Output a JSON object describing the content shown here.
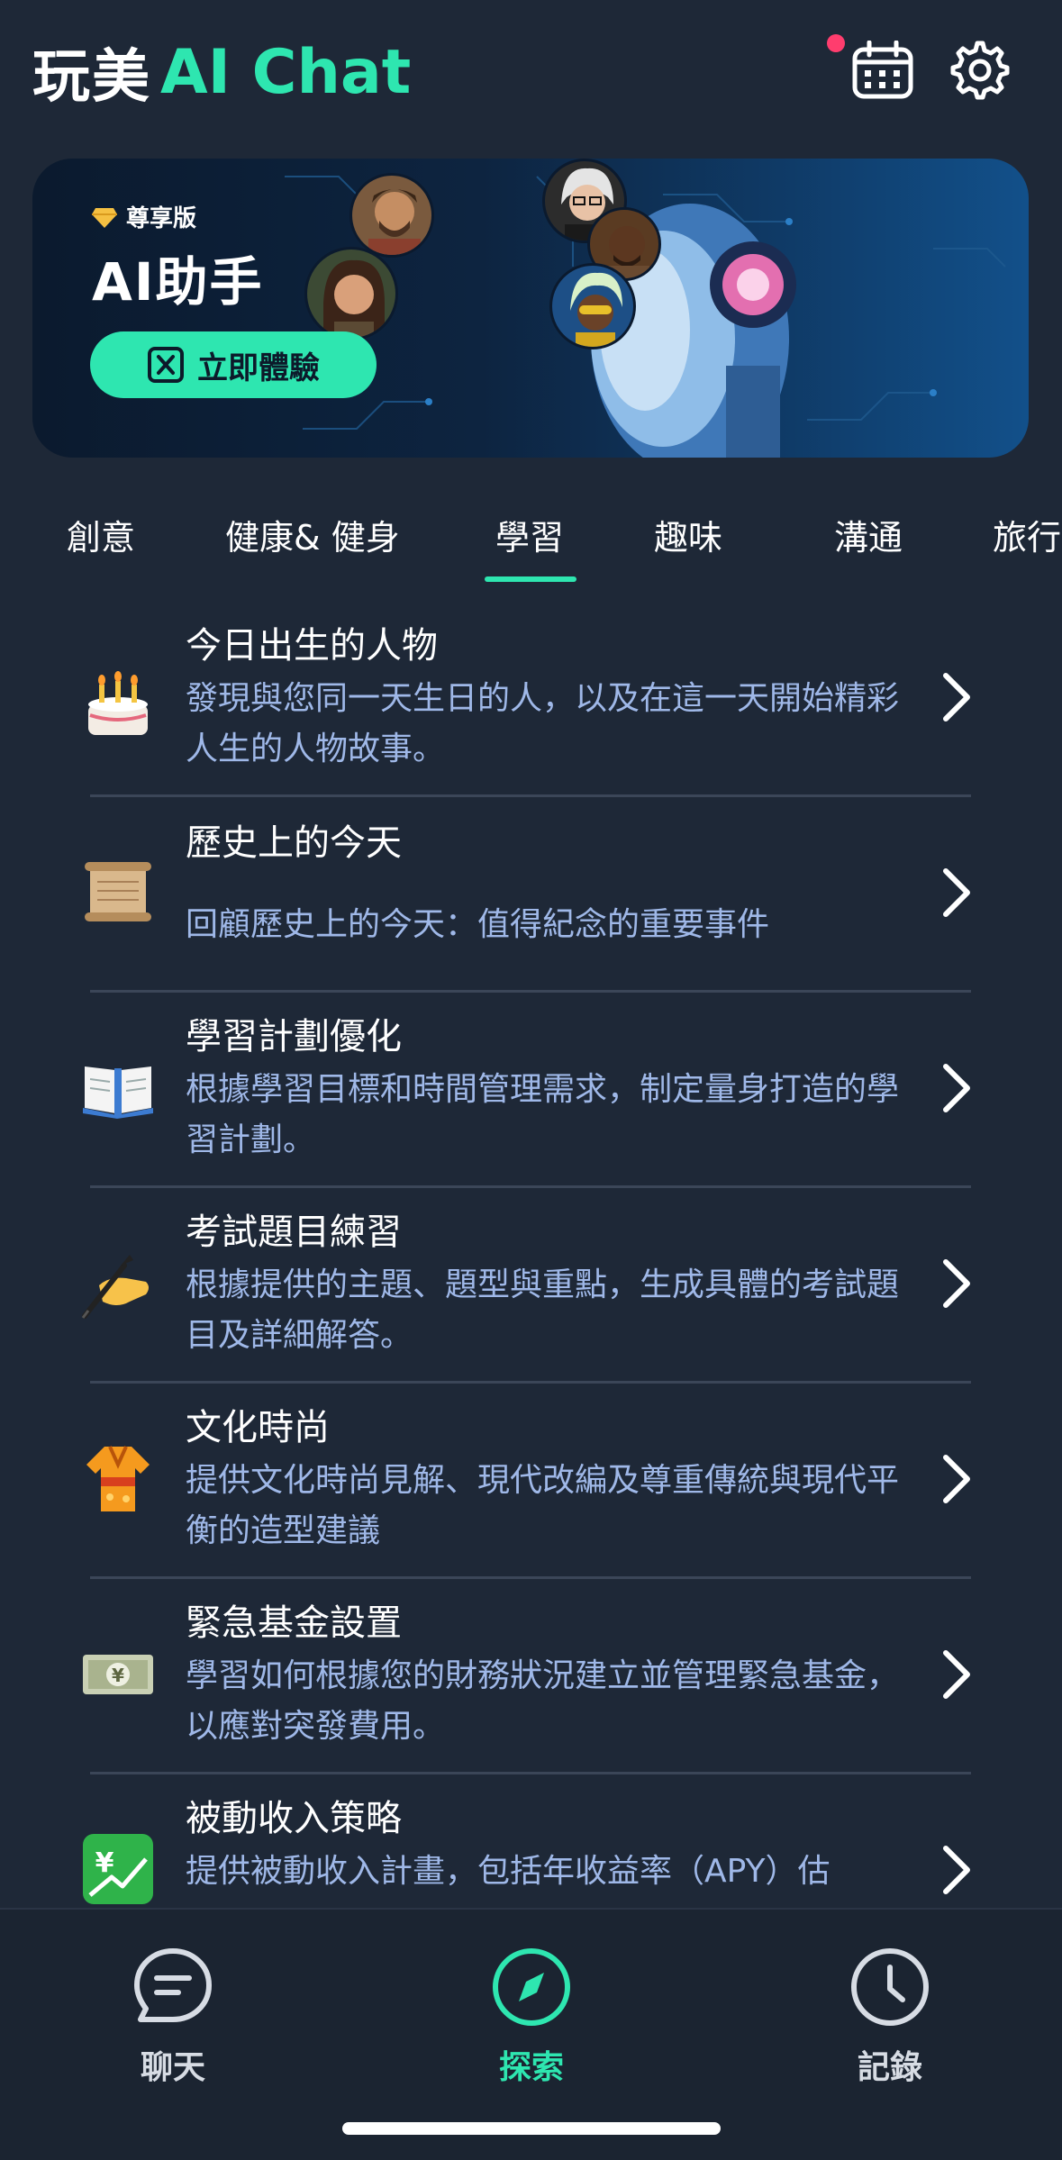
{
  "header": {
    "logo_cn": "玩美",
    "logo_ai": "AI Chat",
    "calendar_icon": "calendar-icon",
    "settings_icon": "gear-icon",
    "notification_color": "#ff3d6e"
  },
  "banner": {
    "premium_label": "尊享版",
    "title": "AI助手",
    "cta_label": "立即體驗",
    "accent": "#2ee6b0"
  },
  "tabs": [
    {
      "label": "創意",
      "active": false
    },
    {
      "label": "健康& 健身",
      "active": false
    },
    {
      "label": "學習",
      "active": true
    },
    {
      "label": "趣味",
      "active": false
    },
    {
      "label": "溝通",
      "active": false
    },
    {
      "label": "旅行",
      "active": false
    }
  ],
  "items": [
    {
      "icon": "birthday-cake-icon",
      "title": "今日出生的人物",
      "desc": "發現與您同一天生日的人，以及在這一天開始精彩人生的人物故事。"
    },
    {
      "icon": "scroll-icon",
      "title": "歷史上的今天",
      "desc": "回顧歷史上的今天：值得紀念的重要事件"
    },
    {
      "icon": "open-book-icon",
      "title": "學習計劃優化",
      "desc": "根據學習目標和時間管理需求，制定量身打造的學習計劃。"
    },
    {
      "icon": "writing-hand-icon",
      "title": "考試題目練習",
      "desc": "根據提供的主題、題型與重點，生成具體的考試題目及詳細解答。"
    },
    {
      "icon": "kimono-icon",
      "title": "文化時尚",
      "desc": "提供文化時尚見解、現代改編及尊重傳統與現代平衡的造型建議"
    },
    {
      "icon": "yen-banknote-icon",
      "title": "緊急基金設置",
      "desc": "學習如何根據您的財務狀況建立並管理緊急基金，以應對突發費用。"
    },
    {
      "icon": "chart-yen-icon",
      "title": "被動收入策略",
      "desc": "提供被動收入計畫，包括年收益率（APY）估"
    }
  ],
  "bottom_nav": [
    {
      "label": "聊天",
      "icon": "chat-bubble-icon",
      "active": false
    },
    {
      "label": "探索",
      "icon": "compass-icon",
      "active": true
    },
    {
      "label": "記錄",
      "icon": "clock-icon",
      "active": false
    }
  ]
}
